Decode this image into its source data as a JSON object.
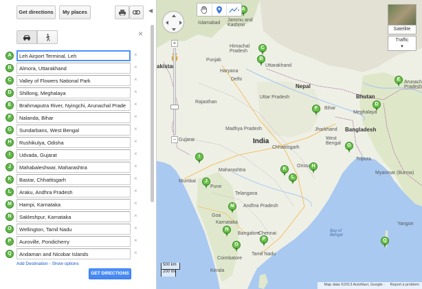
{
  "panel": {
    "get_directions_tab": "Get directions",
    "my_places_tab": "My places",
    "destinations": [
      {
        "marker": "A",
        "value": "Leh Airport Terminal, Leh"
      },
      {
        "marker": "B",
        "value": "Almora, Uttarakhand"
      },
      {
        "marker": "C",
        "value": "Valley of Flowers National Park"
      },
      {
        "marker": "D",
        "value": "Shillong, Meghalaya"
      },
      {
        "marker": "E",
        "value": "Brahmaputra River, Nyingchi, Arunachal Prade"
      },
      {
        "marker": "F",
        "value": "Nalanda, Bihar"
      },
      {
        "marker": "G",
        "value": "Sundarbans, West Bengal"
      },
      {
        "marker": "H",
        "value": "Rushikulya, Odisha"
      },
      {
        "marker": "I",
        "value": "Udvada, Gujarat"
      },
      {
        "marker": "J",
        "value": "Mahabaleshwar, Maharashtra"
      },
      {
        "marker": "K",
        "value": "Bastar, Chhattisgarh"
      },
      {
        "marker": "L",
        "value": "Araku, Andhra Pradesh"
      },
      {
        "marker": "M",
        "value": "Hampi, Karnataka"
      },
      {
        "marker": "N",
        "value": "Sakleshpur, Karnataka"
      },
      {
        "marker": "O",
        "value": "Wellington, Tamil Nadu"
      },
      {
        "marker": "P",
        "value": "Auroville, Pondicherry"
      },
      {
        "marker": "Q",
        "value": "Andaman and Nicobar Islands"
      }
    ],
    "add_destination": "Add Destination",
    "separator": " - ",
    "show_options": "Show options",
    "get_directions_button": "GET DIRECTIONS",
    "accent_color": "#4d90fe",
    "marker_color": "#62b84a"
  },
  "map": {
    "satellite_label": "Satellite",
    "traffic_label": "Traffic",
    "scale_km": "500 km",
    "scale_mi": "200 mi",
    "attribution": "Map data ©2013 AutoNavi, Google -",
    "report_problem": "Report a problem",
    "labels": {
      "islamabad": "Islamabad",
      "jammu": "Jammu and\nKashmir",
      "pakistan": "akistan",
      "himachal": "Himachal\nPradesh",
      "punjab": "Punjab",
      "uttarakhand": "Uttarakhand",
      "haryana": "Haryana",
      "delhi": "Delhi",
      "nepal": "Nepal",
      "bhutan": "Bhutan",
      "rajasthan": "Rajasthan",
      "uttar_pradesh": "Uttar Pradesh",
      "bihar": "Bihar",
      "meghalaya": "Meghalaya",
      "arunachal": "Arunachal\nPradesh",
      "madhya_pradesh": "Madhya Pradesh",
      "jharkhand": "Jharkhand",
      "bangladesh": "Bangladesh",
      "gujarat": "Gujarat",
      "india": "India",
      "west_bengal": "West\nBengal",
      "chhattisgarh": "Chhattisgarh",
      "mumbai": "Mumbai",
      "maharashtra": "Maharashtra",
      "orissa": "Orissa",
      "pune": "Pune",
      "tripura": "Tripura",
      "myanmar": "Myanmar (Burma)",
      "telangana": "Telangana",
      "andhra": "Andhra Pradesh",
      "goa": "Goa",
      "bangalore": "Bangalore",
      "karnataka": "Karnataka",
      "chennai": "Chennai",
      "bay": "Bay of\nBengal",
      "coimbatore": "Coimbatore",
      "tamil_nadu": "Tamil Nadu",
      "kerala": "Kerala",
      "yangon": "Yangon"
    },
    "pins": [
      "A",
      "B",
      "C",
      "D",
      "E",
      "F",
      "G",
      "H",
      "I",
      "J",
      "K",
      "L",
      "M",
      "N",
      "O",
      "P",
      "Q"
    ]
  }
}
